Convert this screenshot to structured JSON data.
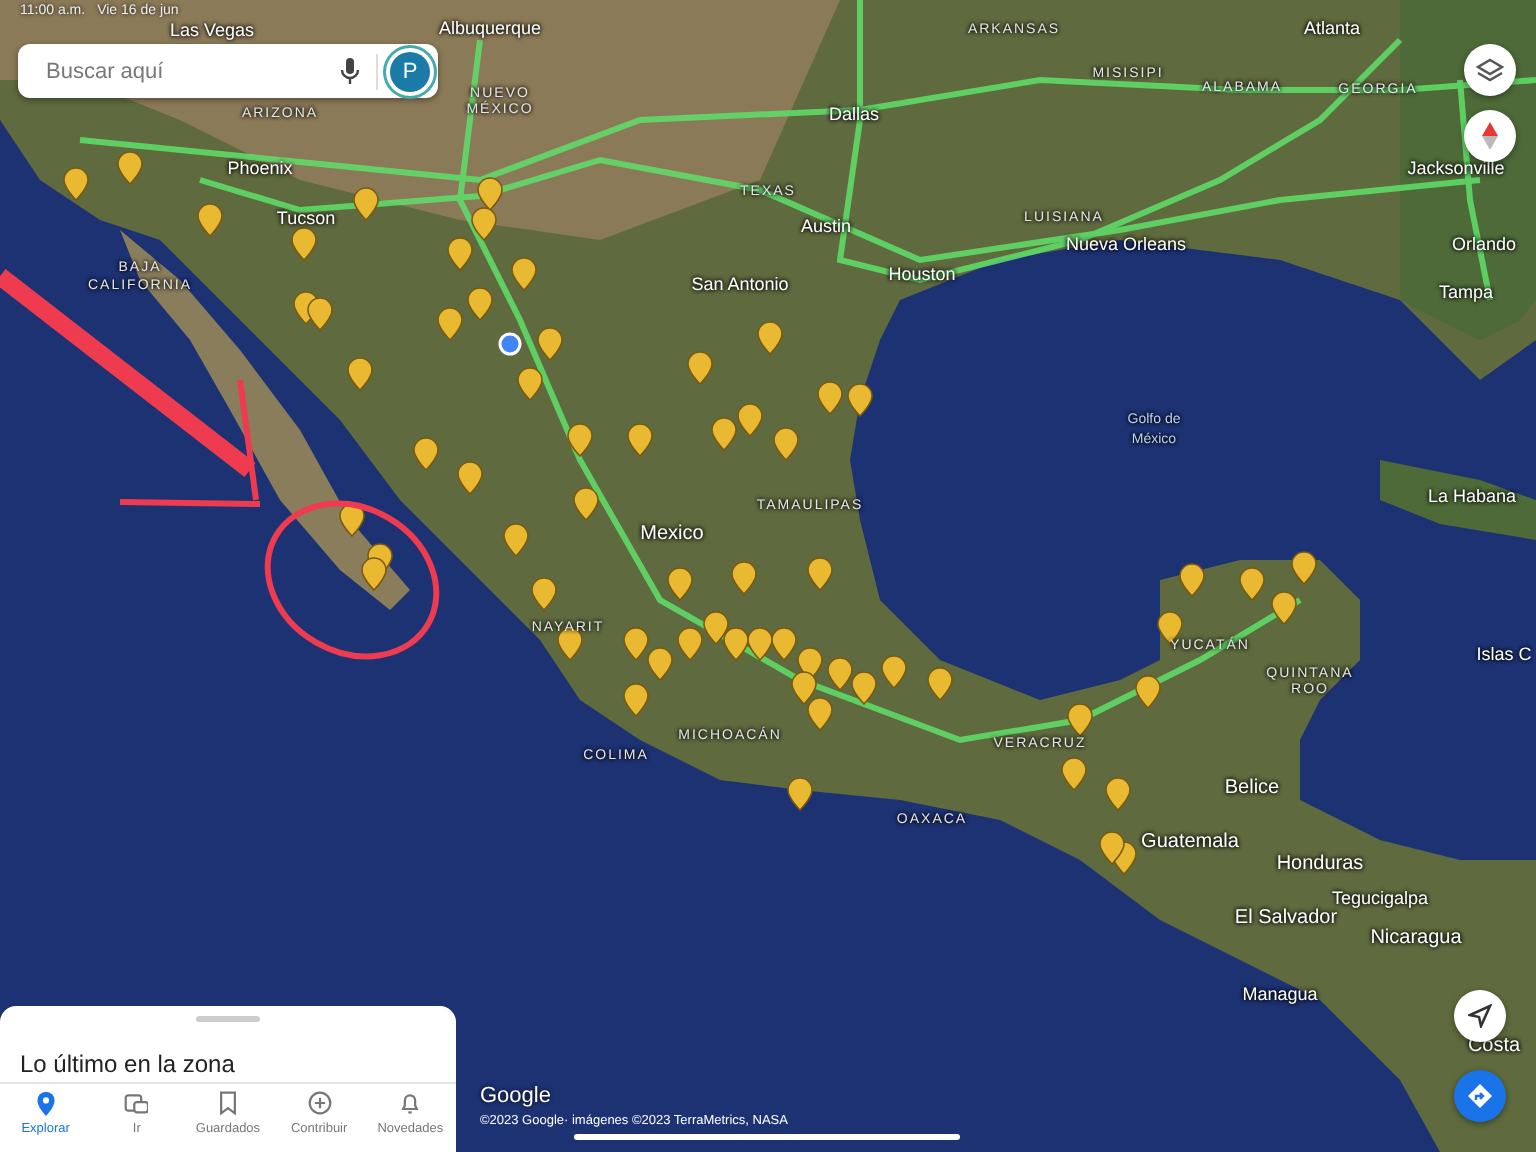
{
  "status_bar": {
    "time": "11:00 a.m.",
    "date": "Vie 16 de jun"
  },
  "search": {
    "placeholder": "Buscar aquí",
    "avatar": "P"
  },
  "map": {
    "labels": [
      {
        "text": "Las Vegas",
        "kind": "city"
      },
      {
        "text": "Albuquerque",
        "kind": "city"
      },
      {
        "text": "NUEVO",
        "kind": "region"
      },
      {
        "text": "MÉXICO",
        "kind": "region"
      },
      {
        "text": "ARIZONA",
        "kind": "region"
      },
      {
        "text": "Phoenix",
        "kind": "city"
      },
      {
        "text": "Tucson",
        "kind": "city"
      },
      {
        "text": "BAJA",
        "kind": "region"
      },
      {
        "text": "CALIFORNIA",
        "kind": "region"
      },
      {
        "text": "ARKANSAS",
        "kind": "region"
      },
      {
        "text": "Atlanta",
        "kind": "city"
      },
      {
        "text": "Dallas",
        "kind": "city"
      },
      {
        "text": "MISISIPI",
        "kind": "region"
      },
      {
        "text": "ALABAMA",
        "kind": "region"
      },
      {
        "text": "GEORGIA",
        "kind": "region"
      },
      {
        "text": "TEXAS",
        "kind": "region"
      },
      {
        "text": "Jacksonville",
        "kind": "city"
      },
      {
        "text": "Austin",
        "kind": "city"
      },
      {
        "text": "LUISIANA",
        "kind": "region"
      },
      {
        "text": "Nueva Orleans",
        "kind": "city"
      },
      {
        "text": "Orlando",
        "kind": "city"
      },
      {
        "text": "Houston",
        "kind": "city"
      },
      {
        "text": "San Antonio",
        "kind": "city"
      },
      {
        "text": "Tampa",
        "kind": "city"
      },
      {
        "text": "Golfo de",
        "kind": "water"
      },
      {
        "text": "México",
        "kind": "water"
      },
      {
        "text": "La Habana",
        "kind": "city"
      },
      {
        "text": "TAMAULIPAS",
        "kind": "region"
      },
      {
        "text": "Mexico",
        "kind": "country"
      },
      {
        "text": "NAYARIT",
        "kind": "region"
      },
      {
        "text": "YUCATÁN",
        "kind": "region"
      },
      {
        "text": "QUINTANA",
        "kind": "region"
      },
      {
        "text": "ROO",
        "kind": "region"
      },
      {
        "text": "Islas C",
        "kind": "city"
      },
      {
        "text": "MICHOACÁN",
        "kind": "region"
      },
      {
        "text": "COLIMA",
        "kind": "region"
      },
      {
        "text": "VERACRUZ",
        "kind": "region"
      },
      {
        "text": "Belice",
        "kind": "country"
      },
      {
        "text": "OAXACA",
        "kind": "region"
      },
      {
        "text": "Guatemala",
        "kind": "country"
      },
      {
        "text": "Honduras",
        "kind": "country"
      },
      {
        "text": "Tegucigalpa",
        "kind": "city"
      },
      {
        "text": "El Salvador",
        "kind": "country"
      },
      {
        "text": "Nicaragua",
        "kind": "country"
      },
      {
        "text": "Managua",
        "kind": "city"
      },
      {
        "text": "Costa",
        "kind": "country"
      }
    ]
  },
  "bottom_sheet": {
    "title": "Lo último en la zona",
    "tabs": [
      {
        "label": "Explorar",
        "selected": true
      },
      {
        "label": "Ir",
        "selected": false
      },
      {
        "label": "Guardados",
        "selected": false
      },
      {
        "label": "Contribuir",
        "selected": false
      },
      {
        "label": "Novedades",
        "selected": false
      }
    ]
  },
  "attribution": {
    "logo": "Google",
    "copyright": "©2023 Google· imágenes ©2023 TerraMetrics, NASA"
  }
}
